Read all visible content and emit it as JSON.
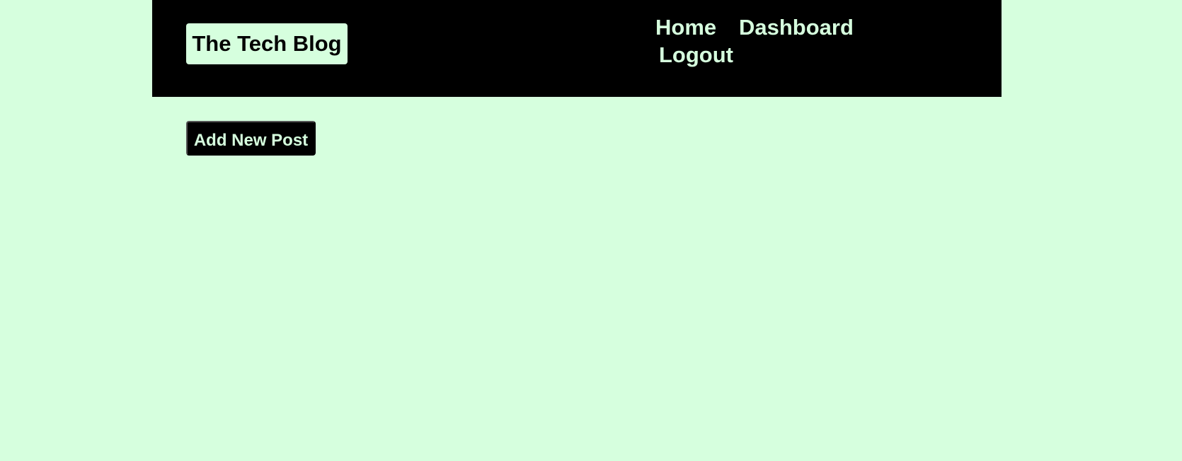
{
  "header": {
    "brand": "The Tech Blog",
    "nav": {
      "home": "Home",
      "dashboard": "Dashboard",
      "logout": "Logout"
    }
  },
  "main": {
    "add_post_label": "Add New Post"
  },
  "colors": {
    "background": "#d6ffde",
    "header_background": "#000000",
    "accent_text": "#d6ffde",
    "dark_text": "#000000"
  }
}
